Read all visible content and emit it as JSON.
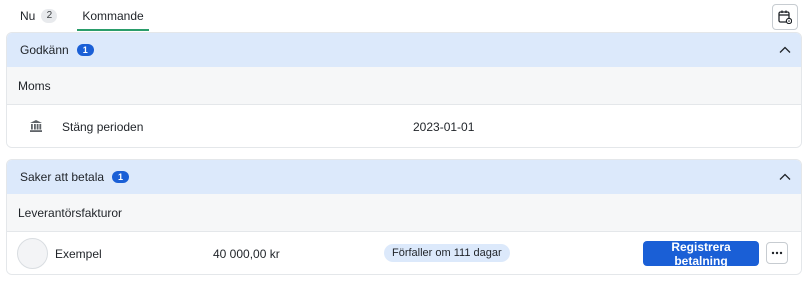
{
  "tabs": [
    {
      "label": "Nu",
      "count": "2",
      "active": false
    },
    {
      "label": "Kommande",
      "active": true
    }
  ],
  "toolbar": {
    "calendar_icon": "calendar-settings-icon"
  },
  "sections": {
    "approve": {
      "title": "Godkänn",
      "count": "1",
      "group_label": "Moms",
      "row": {
        "icon": "bank-icon",
        "label": "Stäng perioden",
        "date": "2023-01-01"
      }
    },
    "pay": {
      "title": "Saker att betala",
      "count": "1",
      "group_label": "Leverantörsfakturor",
      "row": {
        "name": "Exempel",
        "amount": "40 000,00 kr",
        "due": "Förfaller om 111 dagar",
        "action": "Registrera betalning",
        "more": "···"
      }
    }
  },
  "colors": {
    "accent": "#1a5fd6",
    "header_bg": "#dce9fb",
    "tab_underline": "#2a9d6b"
  }
}
